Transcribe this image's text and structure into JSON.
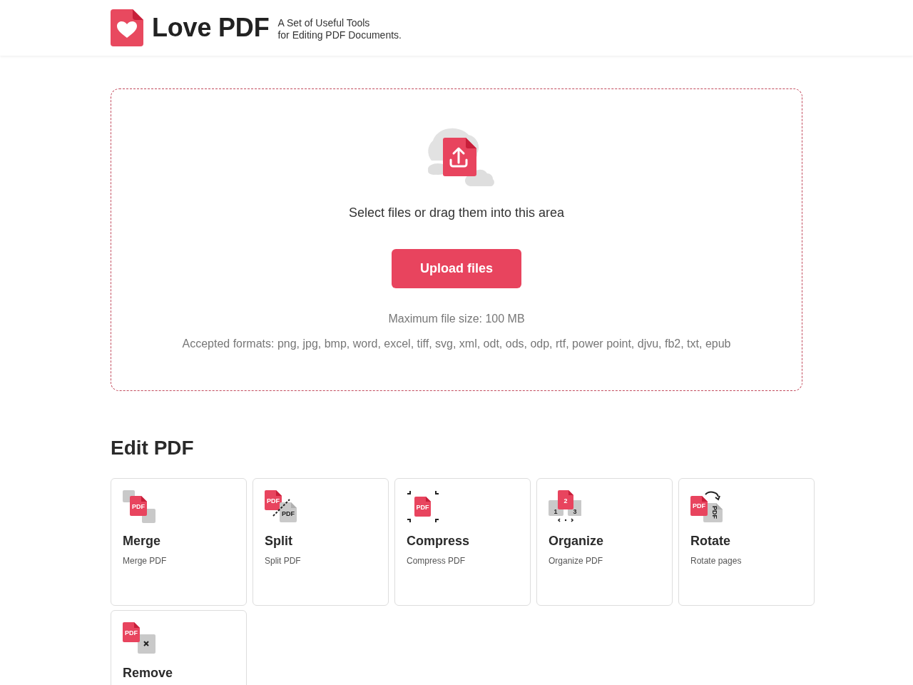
{
  "header": {
    "brand": "Love PDF",
    "tagline": [
      "A Set of Useful Tools",
      "for Editing PDF Documents."
    ]
  },
  "upload": {
    "prompt": "Select files or drag them into this area",
    "button": "Upload files",
    "max_size": "Maximum file size: 100 MB",
    "formats": "Accepted formats: png, jpg, bmp, word, excel, tiff, svg, xml, odt, ods, odp, rtf, power point, djvu, fb2, txt, epub"
  },
  "section": {
    "title": "Edit PDF",
    "tools": [
      {
        "kind": "merge",
        "title": "Merge",
        "description": "Merge PDF",
        "icon_labels": [
          "PDF"
        ]
      },
      {
        "kind": "split",
        "title": "Split",
        "description": "Split PDF",
        "icon_labels": [
          "PDF",
          "PDF"
        ]
      },
      {
        "kind": "compress",
        "title": "Compress",
        "description": "Compress PDF",
        "icon_labels": [
          "PDF"
        ]
      },
      {
        "kind": "organize",
        "title": "Organize",
        "description": "Organize PDF",
        "icon_labels": [
          "2",
          "1",
          "3"
        ]
      },
      {
        "kind": "rotate",
        "title": "Rotate",
        "description": "Rotate pages",
        "icon_labels": [
          "PDF",
          "PDF"
        ]
      },
      {
        "kind": "remove",
        "title": "Remove",
        "icon_labels": [
          "PDF"
        ]
      }
    ]
  }
}
